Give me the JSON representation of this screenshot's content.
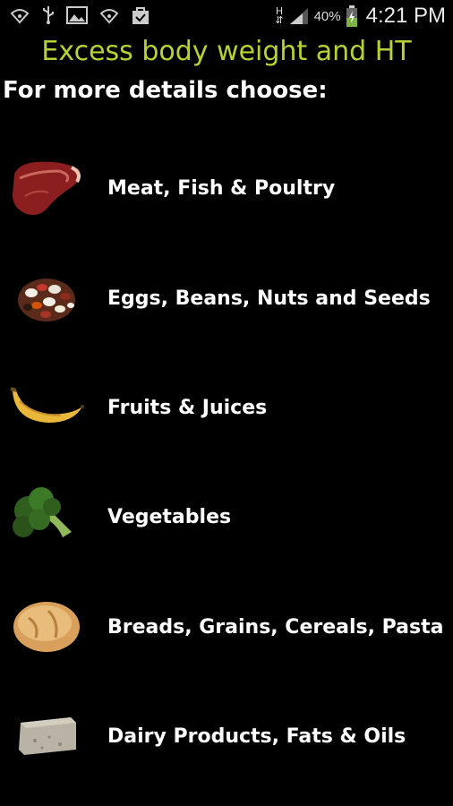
{
  "status_bar": {
    "left_icons": [
      "wifi-hotspot-icon",
      "usb-icon",
      "image-icon",
      "wifi-hotspot-icon",
      "shopping-bag-icon"
    ],
    "network": "H",
    "battery_percent": "40%",
    "time": "4:21 PM"
  },
  "header": {
    "title": "Excess body weight and HT",
    "title_color": "#b5d334",
    "subtitle": "For more details choose:"
  },
  "food_groups": [
    {
      "label": "Meat, Fish & Poultry",
      "icon": "steak-icon"
    },
    {
      "label": "Eggs, Beans, Nuts and Seeds",
      "icon": "beans-icon"
    },
    {
      "label": "Fruits & Juices",
      "icon": "banana-icon"
    },
    {
      "label": "Vegetables",
      "icon": "broccoli-icon"
    },
    {
      "label": "Breads, Grains, Cereals, Pasta",
      "icon": "bread-icon"
    },
    {
      "label": "Dairy Products, Fats & Oils",
      "icon": "cheese-icon"
    }
  ]
}
